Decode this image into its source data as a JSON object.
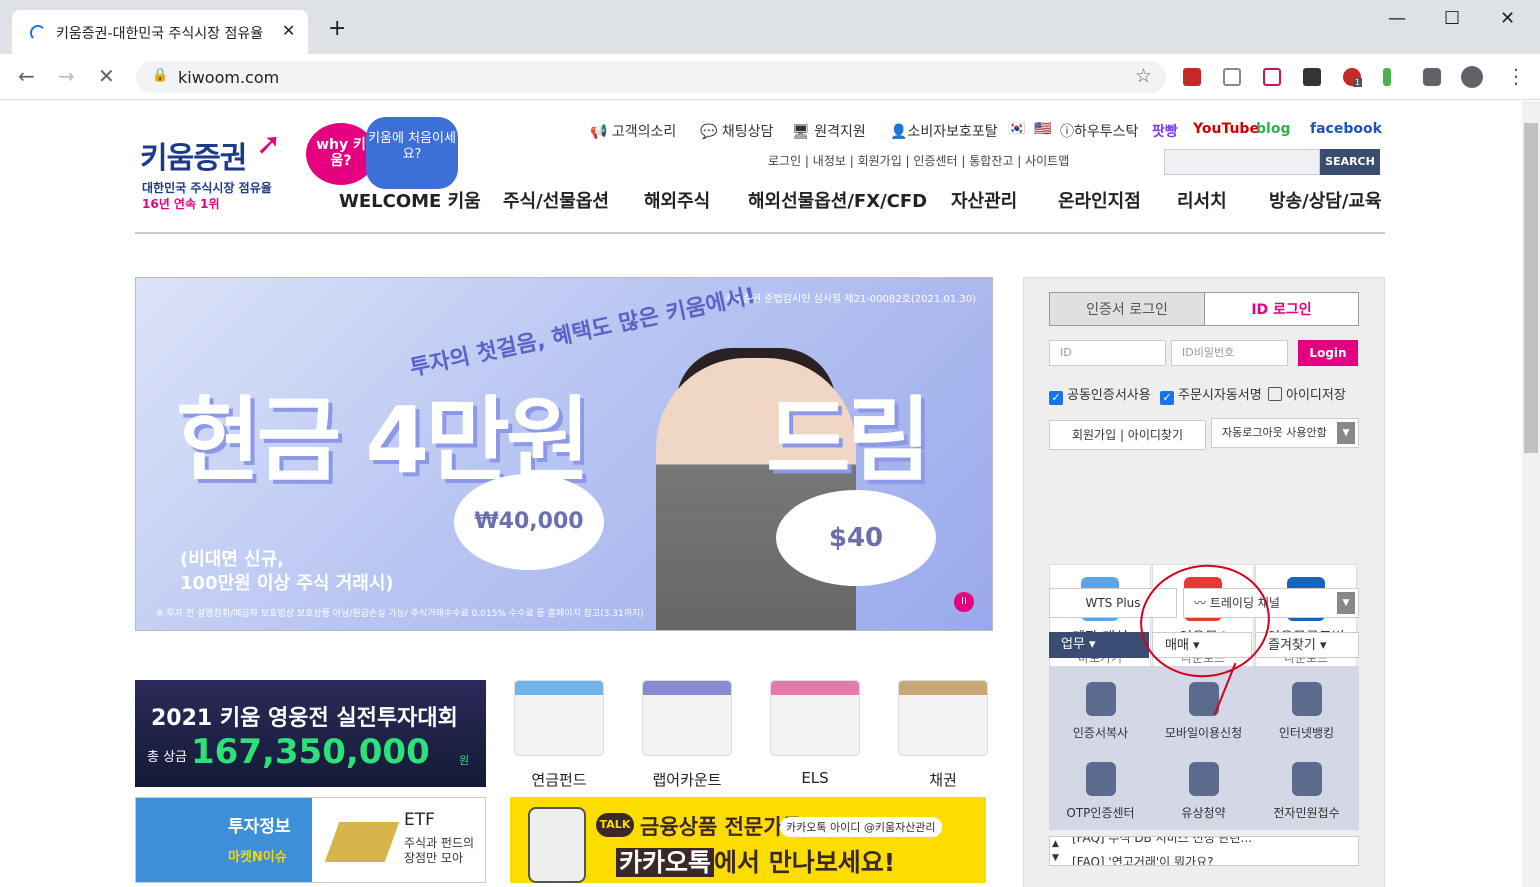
{
  "browser": {
    "tab_title": "키움증권-대한민국 주식시장 점유율",
    "tab_close": "✕",
    "new_tab": "+",
    "url": "kiwoom.com",
    "win_min": "—",
    "win_max": "☐",
    "win_close": "✕",
    "ext_badge": "1"
  },
  "header": {
    "logo_text": "키움증권",
    "logo_sub1": "대한민국 주식시장 점유율",
    "logo_sub2": "16년 연속 1위",
    "bubble1": "why 키움?",
    "bubble2": "키움에 처음이세요?",
    "util": [
      "고객의소리",
      "채팅상담",
      "원격지원",
      "소비자보호포탈",
      "하우투스탁",
      "팟빵",
      "YouTube",
      "blog",
      "facebook"
    ],
    "sublinks": "로그인 | 내정보 | 회원가입 | 인증센터 | 통합잔고 | 사이트맵",
    "search_btn": "SEARCH",
    "gnb": [
      "WELCOME 키움",
      "주식/선물옵션",
      "해외주식",
      "해외선물옵션/FX/CFD",
      "자산관리",
      "온라인지점",
      "리서치",
      "방송/상담/교육"
    ]
  },
  "banner": {
    "notice": "키움증권 준법감시인 심사필 제21-00082호(2021.01.30)",
    "headline": "투자의 첫걸음, 혜택도 많은 키움에서!",
    "big1": "현금 4만원",
    "big2": "드림",
    "bubble_krw": "₩40,000",
    "bubble_usd": "$40",
    "condition1": "(비대면 신규,",
    "condition2": "100만원 이상 주식 거래시)",
    "small": "※ 투자 전 설명청취/예금자 보호법상 보호상품 아님/원금손실 가능/ 주식거래수수료 0.015% 수수료 등 홈페이지 참고(3.31까지)",
    "pause": "II"
  },
  "promos": {
    "contest_title": "2021 키움 영웅전 실전투자대회",
    "contest_prefix": "총 상금",
    "contest_amount": "167,350,000",
    "contest_unit": "원",
    "products": [
      "연금펀드",
      "랩어카운트",
      "ELS",
      "채권"
    ],
    "info_a": "투자정보",
    "info_b": "마켓N이슈",
    "etf_a": "ETF",
    "etf_b1": "주식과 펀드의",
    "etf_b2": "장점만 모아",
    "kakao_talk": "TALK",
    "kakao_t1": "금융상품 전문가를",
    "kakao_t2": "카카오톡 아이디 @키움자산관리",
    "kakao_t3a": "카카오톡",
    "kakao_t3b": "에서 만나보세요!"
  },
  "sidebar": {
    "tab_cert": "인증서 로그인",
    "tab_id": "ID 로그인",
    "id_placeholder": "ID",
    "pw_placeholder": "ID비밀번호",
    "login_btn": "Login",
    "chk1": "공동인증서사용",
    "chk2": "주문시자동서명",
    "chk3": "아이디저장",
    "join": "회원가입 | 아이디찾기",
    "autologout": "자동로그아웃 사용안함",
    "quick": [
      {
        "a": "계좌 개설",
        "b": "바로가기"
      },
      {
        "a": "영웅문4",
        "b": "다운로드"
      },
      {
        "a": "영웅문글로벌",
        "b": "다운로드"
      }
    ],
    "wts": "WTS Plus",
    "trading": "트레이딩 채널",
    "biz": [
      "업무",
      "매매",
      "즐겨찾기"
    ],
    "grid": [
      "인증서복사",
      "모바일이용신청",
      "인터넷뱅킹",
      "OTP인증센터",
      "유상청약",
      "전자민원접수"
    ],
    "faq1": "[FAQ] 주식 DB 서비스 신청 관련...",
    "faq2": "[FAQ] '연고거래'이 뭐가요?"
  }
}
